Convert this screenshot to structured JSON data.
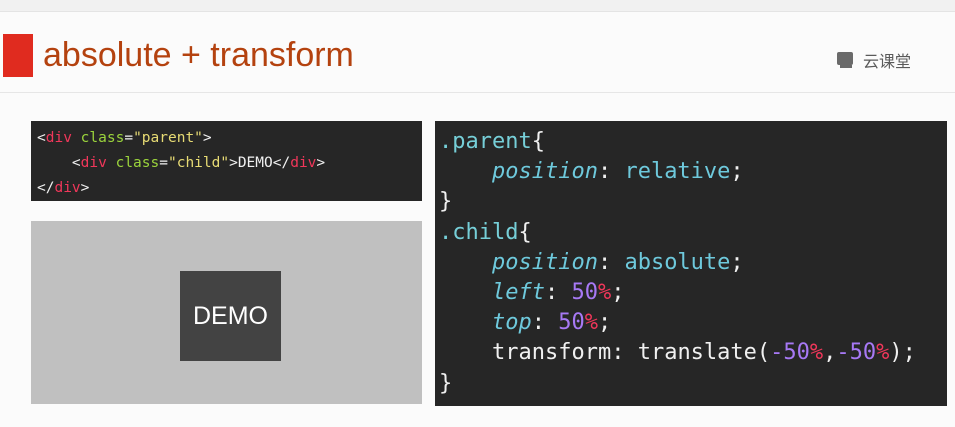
{
  "slide": {
    "title": "absolute + transform",
    "logo_text": "云课堂"
  },
  "html_code": {
    "line1": {
      "open": "<",
      "tag": "div",
      "space": " ",
      "attr": "class",
      "eq": "=",
      "value": "\"parent\"",
      "close": ">"
    },
    "line2": {
      "indent": "    ",
      "open": "<",
      "tag": "div",
      "space": " ",
      "attr": "class",
      "eq": "=",
      "value": "\"child\"",
      "close": ">",
      "text": "DEMO",
      "end_open": "</",
      "end_tag": "div",
      "end_close": ">"
    },
    "line3": {
      "open": "</",
      "tag": "div",
      "close": ">"
    }
  },
  "demo": {
    "label": "DEMO"
  },
  "css_code": {
    "parent_selector": ".parent",
    "open_brace": "{",
    "close_brace": "}",
    "indent": "    ",
    "parent_prop": "position",
    "parent_val": "relative",
    "child_selector": ".child",
    "child_position_prop": "position",
    "child_position_val": "absolute",
    "left_prop": "left",
    "left_num": "50",
    "top_prop": "top",
    "top_num": "50",
    "pct": "%",
    "transform_prop": "transform",
    "transform_fn": "translate(",
    "tx": "-50",
    "comma": ",",
    "ty": "-50",
    "fn_end": ");",
    "colon": ": ",
    "semicolon": ";"
  }
}
